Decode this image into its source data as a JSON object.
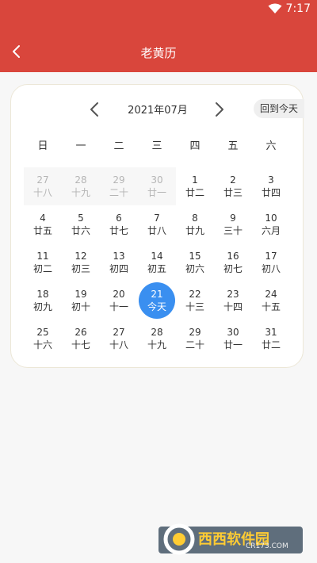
{
  "status_bar": {
    "time": "7:17",
    "wifi_icon": "wifi-icon"
  },
  "app_bar": {
    "title": "老黄历",
    "back_icon": "chevron-left-icon"
  },
  "calendar": {
    "month_label": "2021年07月",
    "today_button": "回到今天",
    "weekdays": [
      "日",
      "一",
      "二",
      "三",
      "四",
      "五",
      "六"
    ],
    "days": [
      {
        "num": "27",
        "lunar": "十八"
      },
      {
        "num": "28",
        "lunar": "十九"
      },
      {
        "num": "29",
        "lunar": "二十"
      },
      {
        "num": "30",
        "lunar": "廿一"
      },
      {
        "num": "1",
        "lunar": "廿二"
      },
      {
        "num": "2",
        "lunar": "廿三"
      },
      {
        "num": "3",
        "lunar": "廿四"
      },
      {
        "num": "4",
        "lunar": "廿五"
      },
      {
        "num": "5",
        "lunar": "廿六"
      },
      {
        "num": "6",
        "lunar": "廿七"
      },
      {
        "num": "7",
        "lunar": "廿八"
      },
      {
        "num": "8",
        "lunar": "廿九"
      },
      {
        "num": "9",
        "lunar": "三十"
      },
      {
        "num": "10",
        "lunar": "六月"
      },
      {
        "num": "11",
        "lunar": "初二"
      },
      {
        "num": "12",
        "lunar": "初三"
      },
      {
        "num": "13",
        "lunar": "初四"
      },
      {
        "num": "14",
        "lunar": "初五"
      },
      {
        "num": "15",
        "lunar": "初六"
      },
      {
        "num": "16",
        "lunar": "初七"
      },
      {
        "num": "17",
        "lunar": "初八"
      },
      {
        "num": "18",
        "lunar": "初九"
      },
      {
        "num": "19",
        "lunar": "初十"
      },
      {
        "num": "20",
        "lunar": "十一"
      },
      {
        "num": "21",
        "lunar": "今天"
      },
      {
        "num": "22",
        "lunar": "十三"
      },
      {
        "num": "23",
        "lunar": "十四"
      },
      {
        "num": "24",
        "lunar": "十五"
      },
      {
        "num": "25",
        "lunar": "十六"
      },
      {
        "num": "26",
        "lunar": "十七"
      },
      {
        "num": "27",
        "lunar": "十八"
      },
      {
        "num": "28",
        "lunar": "十九"
      },
      {
        "num": "29",
        "lunar": "二十"
      },
      {
        "num": "30",
        "lunar": "廿一"
      },
      {
        "num": "31",
        "lunar": "廿二"
      }
    ],
    "other_month_count": 4,
    "selected_index": 24,
    "selected_color": "#3a8ff0"
  },
  "colors": {
    "app_bar": "#d9463c",
    "background": "#f7f7f7"
  },
  "watermark": {
    "text": "西西软件园",
    "sub": "CR173.COM"
  }
}
